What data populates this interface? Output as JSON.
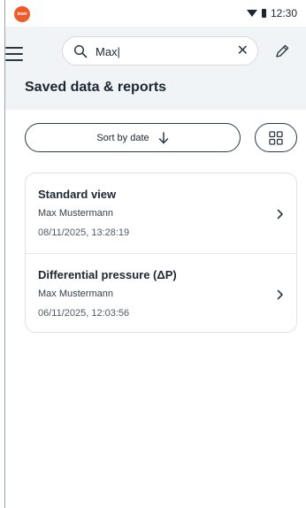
{
  "status_bar": {
    "brand": "testo",
    "time": "12:30",
    "icons": [
      "wifi-icon",
      "battery-icon"
    ]
  },
  "header": {
    "menu_icon": "hamburger-menu-icon",
    "search": {
      "value": "Max|",
      "icon": "search-icon",
      "clear_icon": "close-icon"
    },
    "edit_icon": "pencil-icon",
    "title": "Saved data & reports"
  },
  "toolbar": {
    "sort_label": "Sort by date",
    "sort_icon": "arrow-down-icon",
    "view_toggle_icon": "grid-view-icon"
  },
  "reports": [
    {
      "title": "Standard view",
      "user": "Max Mustermann",
      "date": "08/11/2025, 13:28:19"
    },
    {
      "title": "Differential pressure (ΔP)",
      "user": "Max Mustermann",
      "date": "06/11/2025, 12:03:56"
    }
  ],
  "colors": {
    "brand": "#f05a28",
    "header_bg": "#f1f4f6",
    "text": "#1b2733",
    "border": "#dde2e6"
  }
}
